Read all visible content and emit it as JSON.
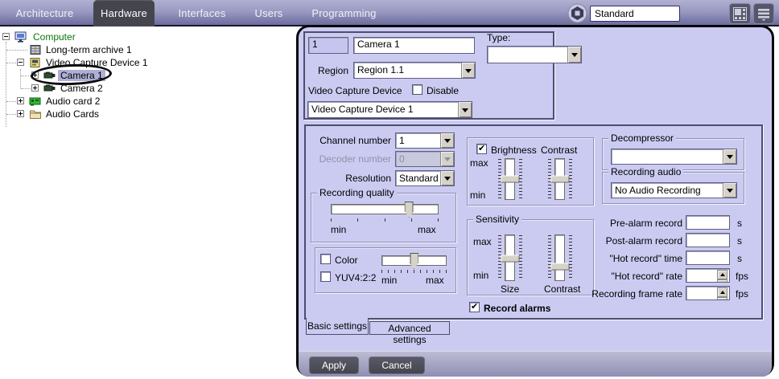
{
  "menubar": {
    "tabs": [
      {
        "label": "Architecture",
        "active": false
      },
      {
        "label": "Hardware",
        "active": true
      },
      {
        "label": "Interfaces",
        "active": false
      },
      {
        "label": "Users",
        "active": false
      },
      {
        "label": "Programming",
        "active": false
      }
    ],
    "profile_value": "Standard",
    "icons": {
      "logo": "cube-logo-icon",
      "layouts": "screen-layout-grid-icon",
      "menu": "hamburger-menu-icon"
    }
  },
  "tree": {
    "items": [
      {
        "label": "Computer",
        "icon": "computer-icon",
        "expand": "minus",
        "selected": false
      },
      {
        "label": "Long-term archive 1",
        "icon": "archive-icon",
        "expand": "none",
        "selected": false
      },
      {
        "label": "Video Capture Device 1",
        "icon": "capture-device-icon",
        "expand": "minus",
        "selected": false
      },
      {
        "label": "Camera 1",
        "icon": "camera-icon",
        "expand": "plus",
        "selected": true,
        "annotated": true
      },
      {
        "label": "Camera 2",
        "icon": "camera-icon",
        "expand": "plus",
        "selected": false
      },
      {
        "label": "Audio card 2",
        "icon": "audio-card-icon",
        "expand": "plus",
        "selected": false
      },
      {
        "label": "Audio Cards",
        "icon": "folder-icon",
        "expand": "plus",
        "selected": false
      }
    ]
  },
  "panel": {
    "id_value": "1",
    "name_value": "Camera 1",
    "region_label": "Region",
    "region_value": "Region 1.1",
    "vcd_label": "Video Capture Device",
    "disable_label": "Disable",
    "disable_checked": false,
    "vcd_value": "Video Capture Device 1",
    "type_label": "Type:",
    "type_value": "",
    "settings": {
      "channel_label": "Channel number",
      "channel_value": "1",
      "decoder_label": "Decoder number",
      "decoder_value": "0",
      "resolution_label": "Resolution",
      "resolution_value": "Standard",
      "recording_quality": {
        "title": "Recording quality",
        "min": "min",
        "max": "max",
        "value_pct": 73
      },
      "color_group": {
        "color_label": "Color",
        "color_checked": false,
        "yuv_label": "YUV4:2:2",
        "yuv_checked": false,
        "min": "min",
        "max": "max",
        "value_pct": 50
      },
      "brightness_group": {
        "brightness_label": "Brightness",
        "brightness_checked": true,
        "contrast_label": "Contrast",
        "max": "max",
        "min": "min",
        "brightness_pct": 50,
        "contrast_pct": 50
      },
      "sensitivity_group": {
        "title": "Sensitivity",
        "max": "max",
        "min": "min",
        "size_label": "Size",
        "contrast_label": "Contrast",
        "size_pct": 52,
        "contrast_pct": 70
      },
      "record_alarms_label": "Record alarms",
      "record_alarms_checked": true,
      "decompressor": {
        "title": "Decompressor",
        "value": ""
      },
      "recording_audio": {
        "title": "Recording audio",
        "value": "No Audio Recording"
      },
      "records": [
        {
          "label": "Pre-alarm record",
          "value": "",
          "unit": "s"
        },
        {
          "label": "Post-alarm record",
          "value": "",
          "unit": "s"
        },
        {
          "label": "\"Hot record\" time",
          "value": "",
          "unit": "s"
        },
        {
          "label": "\"Hot record\" rate",
          "value": "",
          "unit": "fps"
        },
        {
          "label": "Recording frame rate",
          "value": "",
          "unit": "fps"
        }
      ]
    },
    "tabs": [
      {
        "label": "Basic settings",
        "active": true
      },
      {
        "label": "Advanced settings",
        "active": false
      }
    ],
    "apply_label": "Apply",
    "cancel_label": "Cancel"
  }
}
